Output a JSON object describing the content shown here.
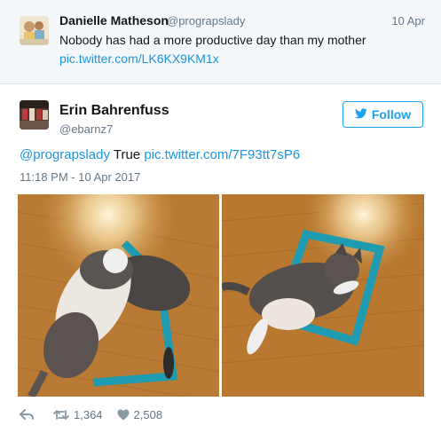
{
  "parent_tweet": {
    "name": "Danielle Matheson",
    "handle": "@prograpslady",
    "date": "10 Apr",
    "text": "Nobody has had a more productive day than my mother",
    "link": "pic.twitter.com/LK6KX9KM1x"
  },
  "tweet": {
    "name": "Erin Bahrenfuss",
    "handle": "@ebarnz7",
    "follow_label": "Follow",
    "mention": "@prograpslady",
    "text": " True ",
    "link": "pic.twitter.com/7F93tt7sP6",
    "timestamp": "11:18 PM - 10 Apr 2017"
  },
  "actions": {
    "retweets": "1,364",
    "likes": "2,508"
  },
  "icons": [
    "reply-icon",
    "retweet-icon",
    "heart-icon",
    "twitter-bird-icon"
  ],
  "colors": {
    "link": "#1b95e0",
    "follow": "#1da1f2",
    "muted": "#657786",
    "parent_bg": "#f5f8fa",
    "tape": "#1e9bb0",
    "floor": "#b7782f"
  }
}
